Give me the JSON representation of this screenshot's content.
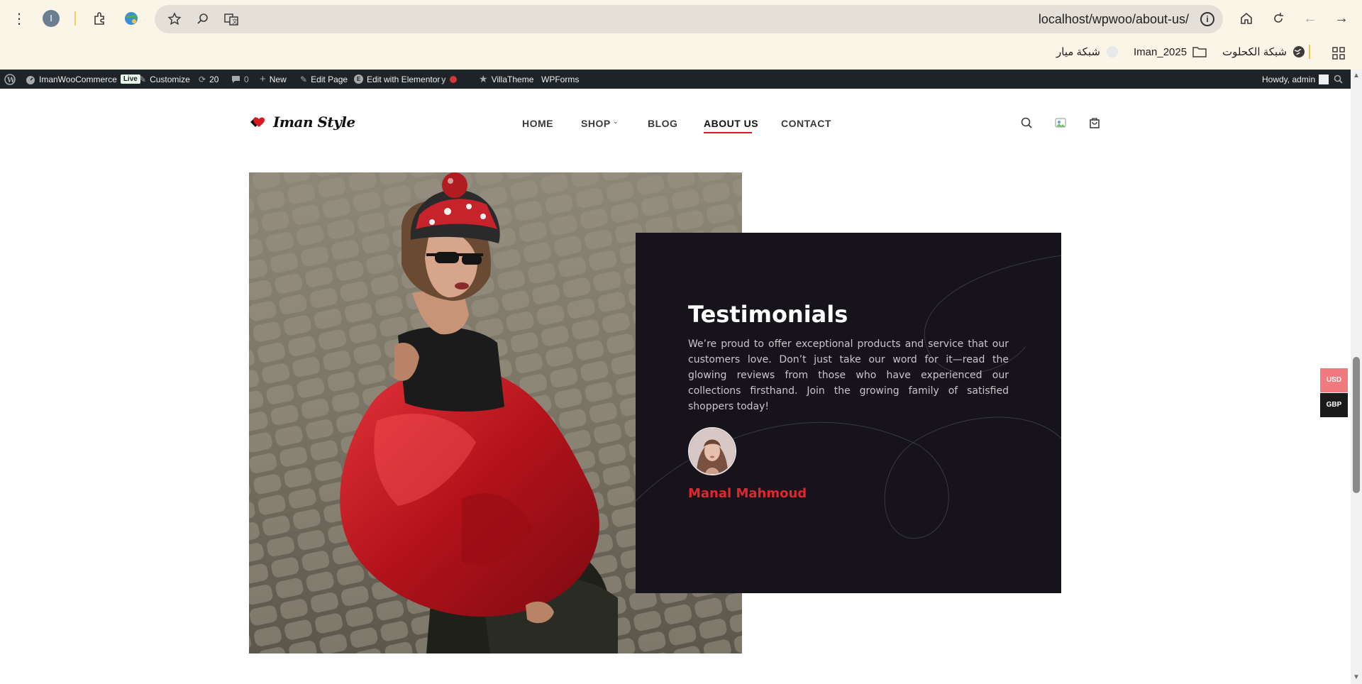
{
  "browser": {
    "url": "localhost/wpwoo/about-us/",
    "profile_initial": "I",
    "bookmarks": [
      {
        "label": "شبكة الكحلوت",
        "icon": "globe-icon"
      },
      {
        "label": "Iman_2025",
        "icon": "folder-icon"
      },
      {
        "label": "شبكة ميار",
        "icon": "moon-icon"
      }
    ]
  },
  "wp_admin_bar": {
    "site_name": "ImanWooCommerce",
    "live_badge": "Live",
    "customize": "Customize",
    "updates_count": "20",
    "comments_count": "0",
    "new": "New",
    "edit_page": "Edit Page",
    "edit_elementor": "Edit with Elementor",
    "villatheme": "VillaTheme",
    "wpforms": "WPForms",
    "howdy": "Howdy, admin"
  },
  "site": {
    "logo_text": "Iman Style",
    "nav": {
      "home": "HOME",
      "shop": "SHOP",
      "blog": "BLOG",
      "about": "ABOUT US",
      "contact": "CONTACT"
    }
  },
  "testimonials": {
    "title": "Testimonials",
    "text": "We’re proud to offer exceptional products and service that our customers love. Don’t just take our word for it—read the glowing reviews from those who have experienced our collections firsthand. Join the growing family of satisfied shoppers today!",
    "author": "Manal Mahmoud"
  },
  "currency": {
    "usd": "USD",
    "gbp": "GBP"
  },
  "colors": {
    "accent_red": "#d71920",
    "card_bg": "#16141a",
    "wp_bar": "#1d2327"
  }
}
